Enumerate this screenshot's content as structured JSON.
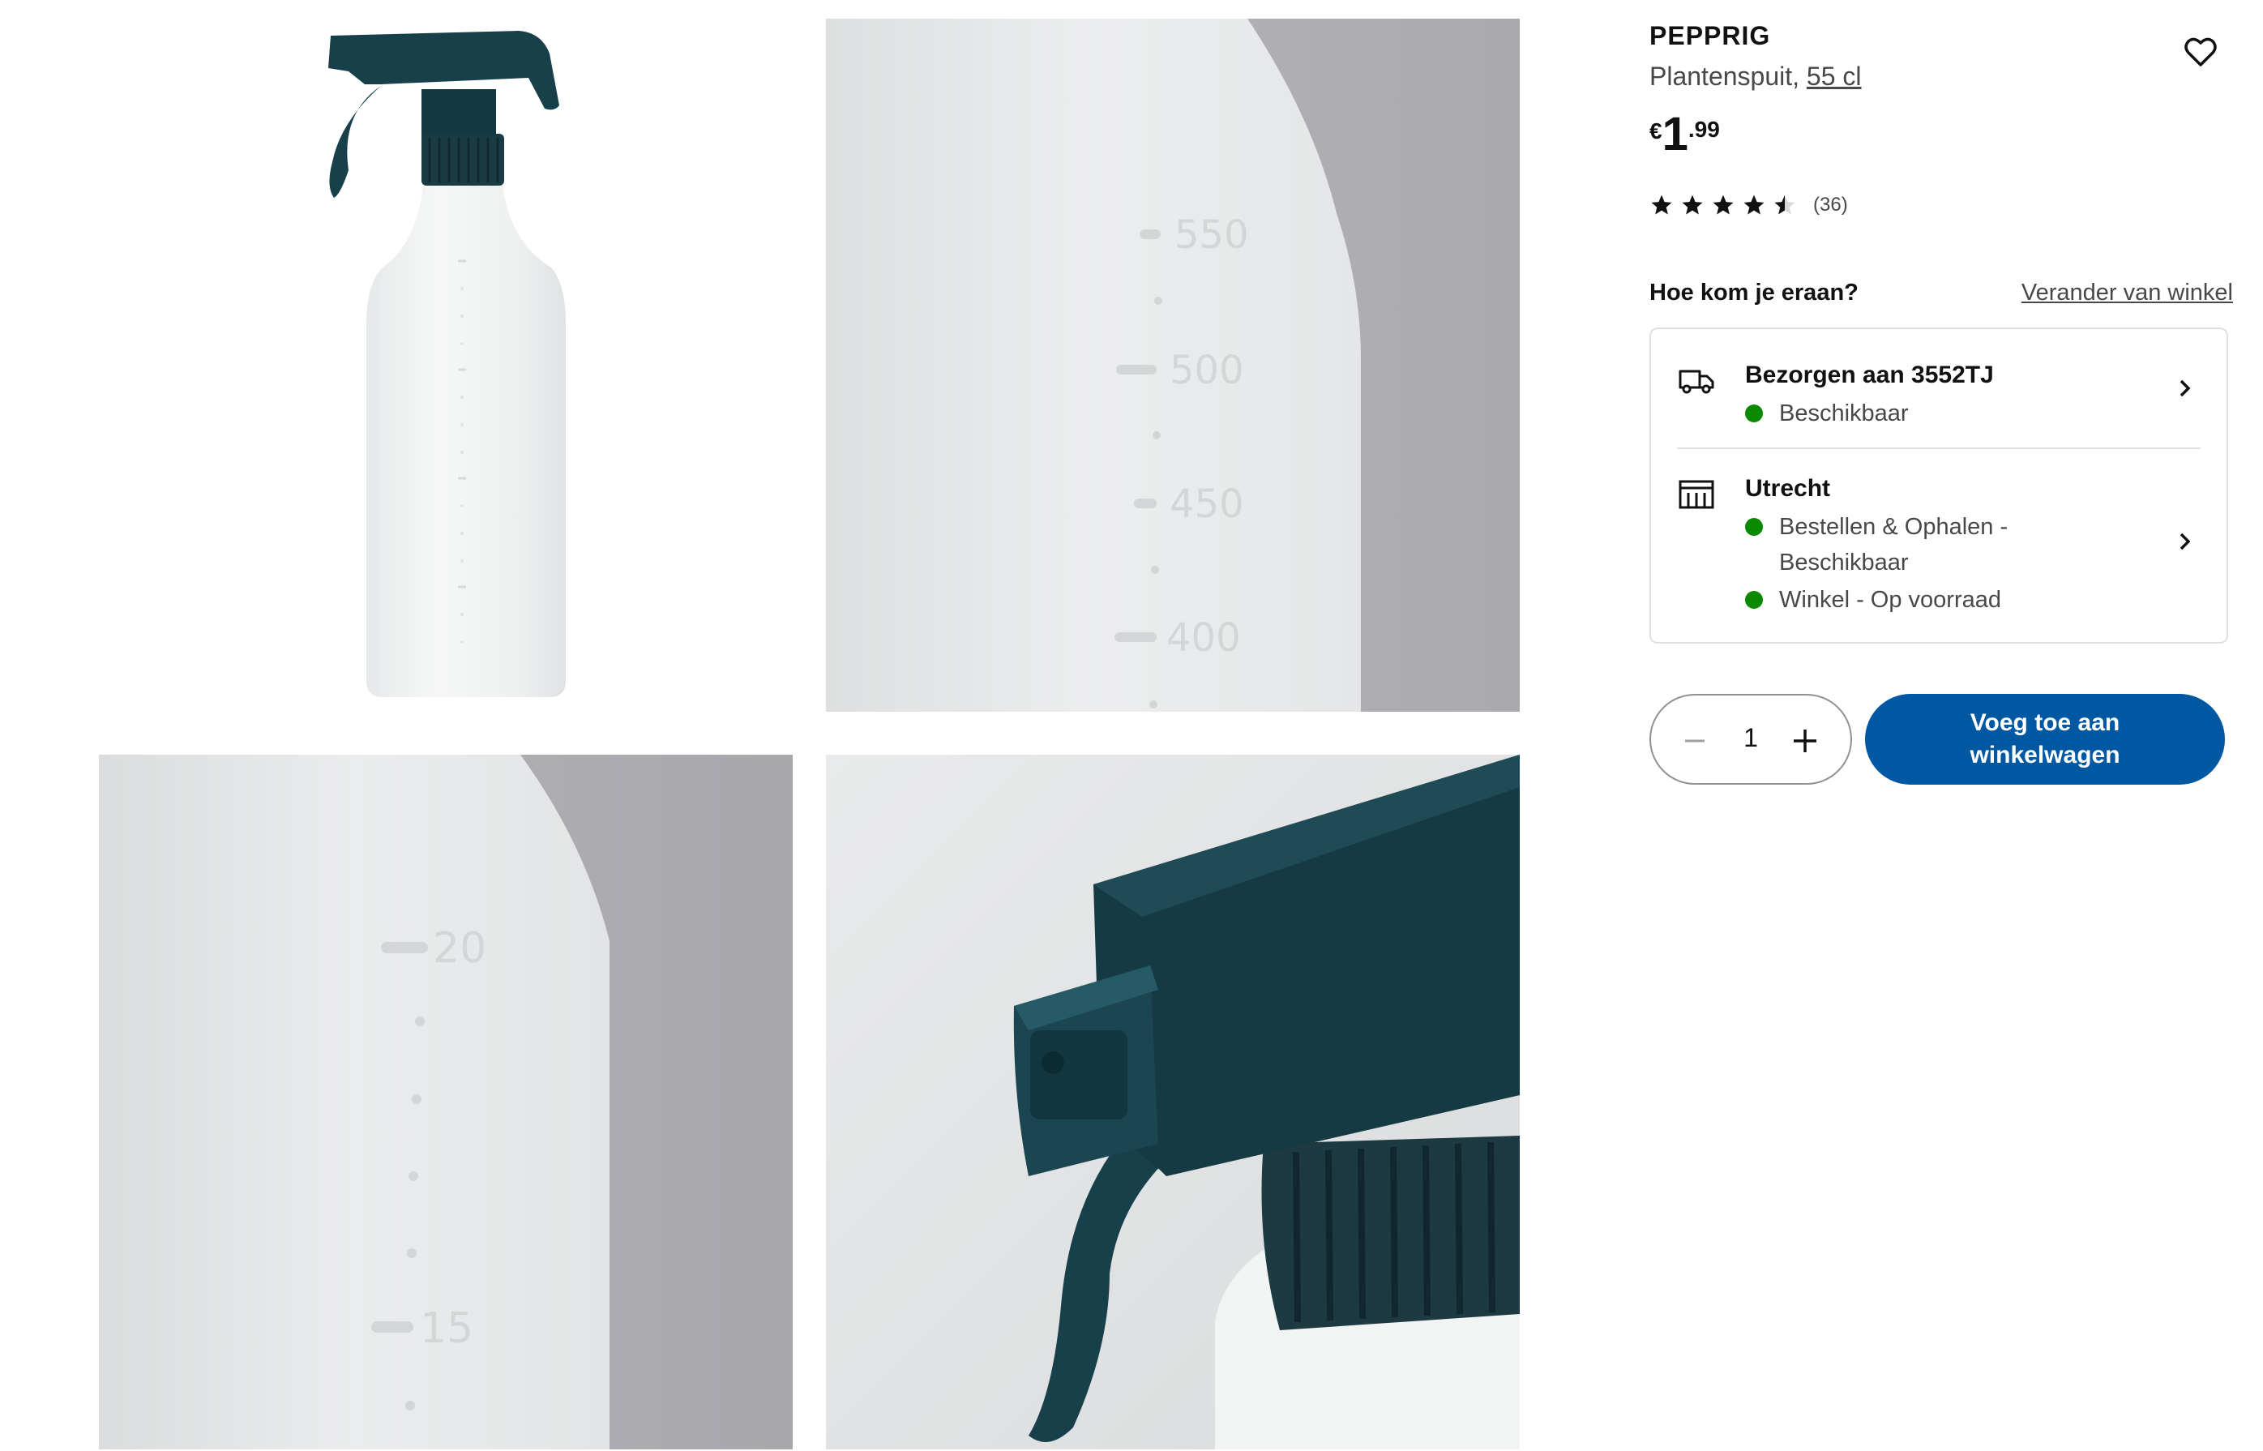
{
  "gallery": {
    "images": [
      {
        "alt": "Plantenspuit product photo"
      },
      {
        "alt": "Close-up of measuring scale"
      },
      {
        "alt": "Close-up of measuring scale"
      },
      {
        "alt": "Close-up of spray head"
      }
    ],
    "scale_large": [
      "550",
      "500",
      "450",
      "400"
    ],
    "scale_small": [
      "20",
      "15"
    ]
  },
  "product": {
    "brand": "PEPPRIG",
    "type": "Plantenspuit,",
    "size": "55 cl",
    "price_currency": "€",
    "price_integer": "1",
    "price_decimal": ".99",
    "rating_value": 4.5,
    "rating_max": 5,
    "rating_count": "(36)",
    "favourite_icon": "heart-outline-icon"
  },
  "availability": {
    "heading": "Hoe kom je eraan?",
    "change_store": "Verander van winkel",
    "delivery": {
      "icon": "truck-icon",
      "title": "Bezorgen aan 3552TJ",
      "status": "Beschikbaar"
    },
    "store": {
      "icon": "store-icon",
      "title": "Utrecht",
      "status_pickup": "Bestellen & Ophalen - Beschikbaar",
      "status_instore": "Winkel - Op voorraad"
    },
    "status_color": "#0a8a00"
  },
  "cart": {
    "quantity": "1",
    "add_label": "Voeg toe aan winkelwagen",
    "button_color": "#0058a3"
  }
}
